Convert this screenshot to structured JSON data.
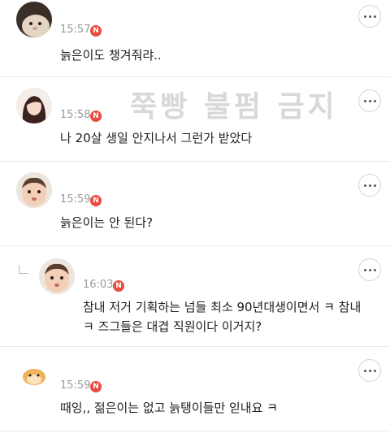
{
  "watermark": "쭉빵 불펌 금지",
  "comments": [
    {
      "time": "15:57",
      "badge": "N",
      "text": "늙은이도 챙겨줘랴..",
      "avatar_icon": "hamster-photo-avatar"
    },
    {
      "time": "15:58",
      "badge": "N",
      "text": "나 20살 생일 안지나서 그런가 받았다",
      "avatar_icon": "woman-photo-avatar"
    },
    {
      "time": "15:59",
      "badge": "N",
      "text": "늙은이는 안 된다?",
      "avatar_icon": "baby-photo-avatar"
    },
    {
      "time": "16:03",
      "badge": "N",
      "text": "참내 저거 기획하는 넘들 최소 90년대생이면서 ㅋ 참내\nㅋ 즈그들은 대겹 직원이다 이거지?",
      "avatar_icon": "baby-photo-avatar",
      "is_reply": true
    },
    {
      "time": "15:59",
      "badge": "N",
      "text": "때잉,, 젊은이는 없고 늙탱이들만 읻내요 ㅋ",
      "avatar_icon": "hamster-cartoon-avatar"
    }
  ],
  "colors": {
    "badge": "#ea4b3f",
    "time": "#9a9a9a",
    "divider": "#e9e9e9",
    "watermark": "#d8d8d8"
  },
  "more_icon": "more-horizontal-icon"
}
